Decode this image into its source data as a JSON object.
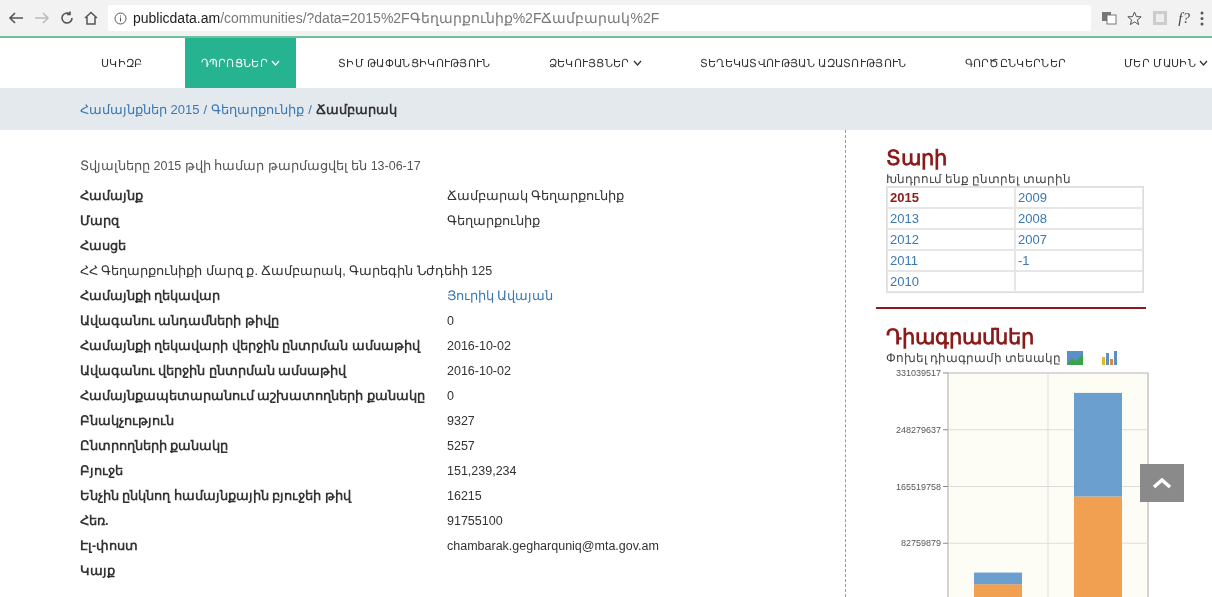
{
  "browser": {
    "url_host": "publicdata.am",
    "url_path": "/communities/?data=2015%2FԳեղարքունիք%2FՃամբարակ%2F",
    "extension_label": "f?"
  },
  "nav": [
    {
      "label": "ՍԿԻԶԲ",
      "selected": false,
      "dropdown": false
    },
    {
      "label": "ԴՊՐՈՑՆԵՐ",
      "selected": true,
      "dropdown": true
    },
    {
      "label": "ՏԻՄ ԹԱՓԱՆՑԻԿՈՒԹՅՈՒՆ",
      "selected": false,
      "dropdown": false
    },
    {
      "label": "ՁԵԿՈՒՅՑՆԵՐ",
      "selected": false,
      "dropdown": true
    },
    {
      "label": "ՏԵՂԵԿԱՏՎՈՒԹՅԱՆ ԱԶԱՏՈՒԹՅՈՒՆ",
      "selected": false,
      "dropdown": false
    },
    {
      "label": "ԳՈՐԾԸՆԿԵՐՆԵՐ",
      "selected": false,
      "dropdown": false
    },
    {
      "label": "ՄԵՐ ՄԱՍԻՆ",
      "selected": false,
      "dropdown": true
    }
  ],
  "breadcrumb": [
    {
      "label": "Համայնքներ 2015",
      "current": false
    },
    {
      "label": "Գեղարքունիք",
      "current": false,
      "separator_before": "/"
    },
    {
      "label": "Ճամբարակ",
      "current": true,
      "separator_before": "/"
    }
  ],
  "updated_note": "Տվյալները 2015 թվի համար թարմացվել են 13-06-17",
  "fields": [
    {
      "kind": "pair",
      "label": "Համայնք",
      "value": "Ճամբարակ Գեղարքունիք"
    },
    {
      "kind": "pair",
      "label": "Մարզ",
      "value": "Գեղարքունիք"
    },
    {
      "kind": "pair",
      "label": "Հասցե"
    },
    {
      "kind": "line",
      "value": "ՀՀ Գեղարքունիքի մարզ ք. Ճամբարակ, Գարեգին Նժդեհի 125"
    },
    {
      "kind": "link",
      "label": "Համայնքի ղեկավար",
      "value": "Յուրիկ Ավայան"
    },
    {
      "kind": "pair",
      "label": "Ավագանու անդամների թիվը",
      "value": "0"
    },
    {
      "kind": "pair",
      "label": "Համայնքի ղեկավարի վերջին ընտրման ամսաթիվ",
      "value": "2016-10-02"
    },
    {
      "kind": "pair",
      "label": "Ավագանու վերջին ընտրման ամսաթիվ",
      "value": "2016-10-02"
    },
    {
      "kind": "pair",
      "label": "Համայնքապետարանում աշխատողների քանակը",
      "value": "0"
    },
    {
      "kind": "pair",
      "label": "Բնակչություն",
      "value": "9327"
    },
    {
      "kind": "pair",
      "label": "Ընտրողների քանակը",
      "value": "5257"
    },
    {
      "kind": "pair",
      "label": "Բյուջե",
      "value": "151,239,234"
    },
    {
      "kind": "pair",
      "label": "Ենչին ընկնող համայնքային բյուջեի թիվ",
      "value": "16215"
    },
    {
      "kind": "pair",
      "label": "Հեռ.",
      "value": "91755100"
    },
    {
      "kind": "pair",
      "label": "Էլ-փոստ",
      "value": "chambarak.gegharquniq@mta.gov.am"
    },
    {
      "kind": "pair",
      "label": "Կայք"
    }
  ],
  "year_panel": {
    "title": "Տարի",
    "hint": "Խնդրում ենք ընտրել տարին",
    "years": [
      {
        "label": "2015",
        "selected": true
      },
      {
        "label": "2009",
        "selected": false
      },
      {
        "label": "2013",
        "selected": false
      },
      {
        "label": "2008",
        "selected": false
      },
      {
        "label": "2012",
        "selected": false
      },
      {
        "label": "2007",
        "selected": false
      },
      {
        "label": "2011",
        "selected": false
      },
      {
        "label": "-1",
        "selected": false
      },
      {
        "label": "2010",
        "selected": false
      }
    ]
  },
  "chart_panel": {
    "title": "Դիագրամներ",
    "hint": "Փոխել դիագրամի տեսակը",
    "chart_data": {
      "type": "bar",
      "stacked": true,
      "grid": true,
      "ylim": [
        0,
        331039517
      ],
      "yticks": [
        82759879,
        165519758,
        248279637,
        331039517
      ],
      "series": [
        {
          "color": "#f0a050",
          "values": [
            23000000,
            151000000
          ]
        },
        {
          "color": "#6b9fcf",
          "values": [
            17000000,
            151000000
          ]
        }
      ]
    }
  }
}
